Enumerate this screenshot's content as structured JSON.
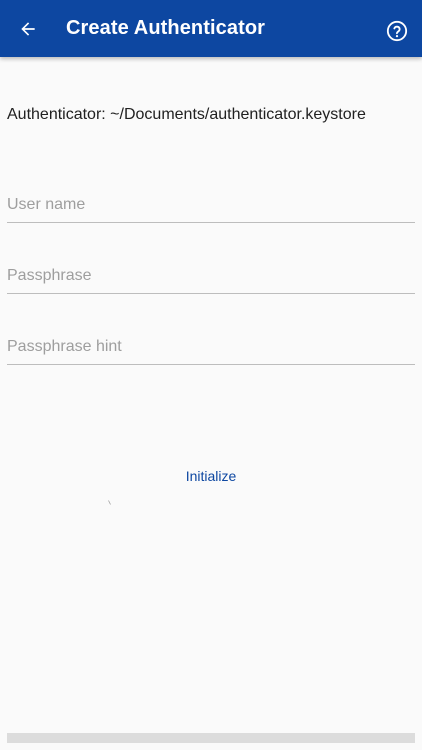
{
  "app_bar": {
    "title": "Create Authenticator",
    "background": "#0d47a1",
    "back_icon": "arrow-left-icon",
    "help_icon": "help-circle-icon"
  },
  "authenticator": {
    "label": "Authenticator: ~/Documents/authenticator.keystore"
  },
  "form": {
    "user_name": {
      "value": "",
      "placeholder": "User name"
    },
    "passphrase": {
      "value": "",
      "placeholder": "Passphrase"
    },
    "passphrase_hint": {
      "value": "",
      "placeholder": "Passphrase hint"
    }
  },
  "actions": {
    "initialize_label": "Initialize",
    "accent": "#0d47a1"
  }
}
